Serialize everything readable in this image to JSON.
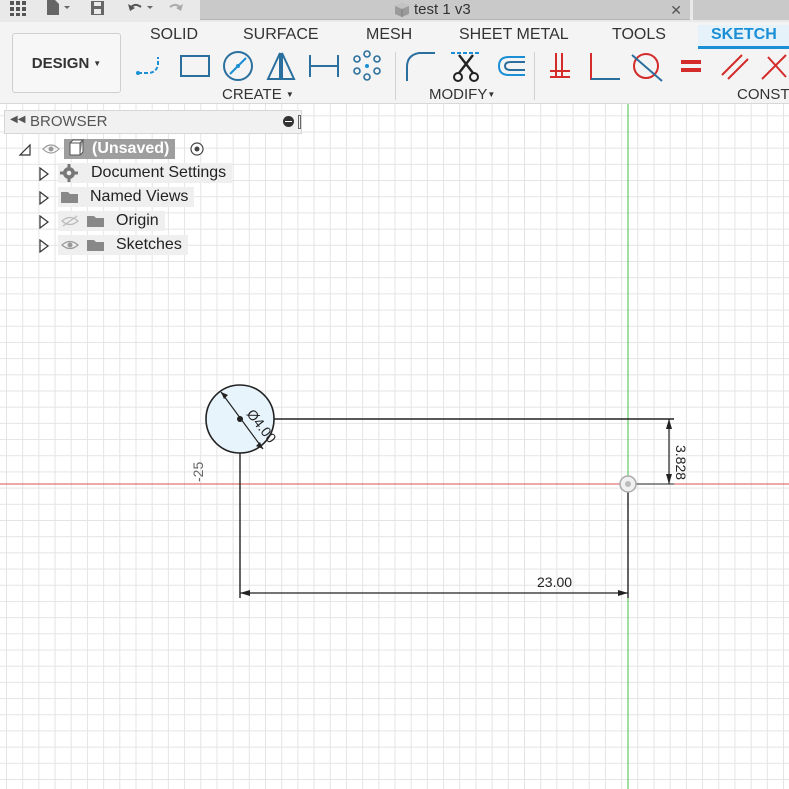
{
  "document": {
    "title": "test 1 v3",
    "close_glyph": "✕"
  },
  "quick_access": [
    "grid-menu-icon",
    "file-icon",
    "save-icon",
    "undo-icon",
    "redo-icon"
  ],
  "workspace": {
    "label": "DESIGN"
  },
  "tabs": [
    {
      "label": "SOLID",
      "active": false
    },
    {
      "label": "SURFACE",
      "active": false
    },
    {
      "label": "MESH",
      "active": false
    },
    {
      "label": "SHEET METAL",
      "active": false
    },
    {
      "label": "TOOLS",
      "active": false
    },
    {
      "label": "SKETCH",
      "active": true
    }
  ],
  "groups": {
    "create": "CREATE",
    "modify": "MODIFY",
    "constraints": "CONST"
  },
  "browser": {
    "title": "BROWSER",
    "root": "(Unsaved)",
    "items": [
      {
        "label": "Document Settings",
        "icon": "gear-icon"
      },
      {
        "label": "Named Views",
        "icon": "folder-icon"
      },
      {
        "label": "Origin",
        "icon": "folder-icon",
        "visibility": "hidden"
      },
      {
        "label": "Sketches",
        "icon": "folder-icon",
        "visibility": "visible"
      }
    ]
  },
  "sketch": {
    "diameter_label": "Ø4.00",
    "vertical_dim_label": "3.828",
    "horizontal_dim_label": "23.00",
    "axis_label": "-25"
  },
  "colors": {
    "accent": "#1a8fd6",
    "x_axis": "#d9534f",
    "y_axis": "#3fbf3f",
    "circle_fill": "#e8f4fb",
    "constraint_red": "#d42b2b"
  }
}
